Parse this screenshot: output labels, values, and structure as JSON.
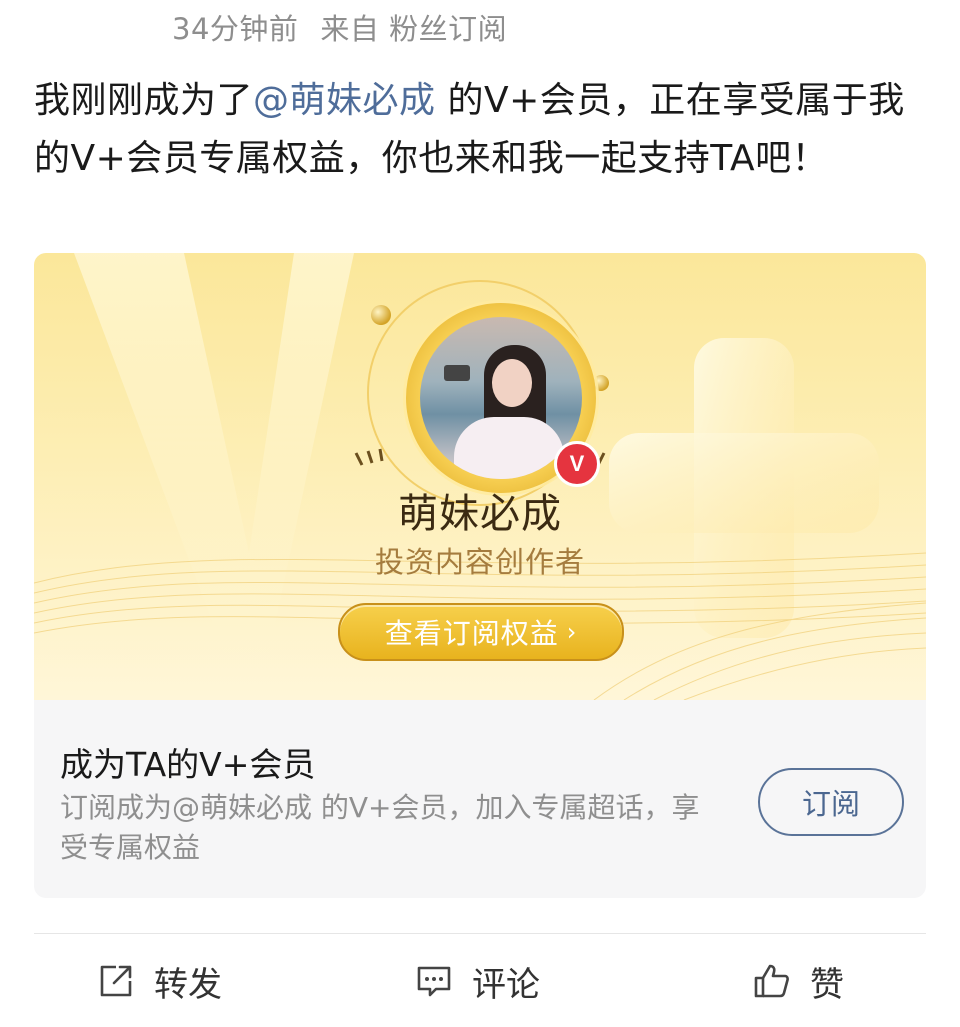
{
  "post": {
    "time": "34分钟前",
    "source": "来自 粉丝订阅",
    "text_before": "我刚刚成为了",
    "mention": "@萌妹必成",
    "text_after": " 的V+会员，正在享受属于我的V+会员专属权益，你也来和我一起支持TA吧！"
  },
  "banner": {
    "creator_name": "萌妹必成",
    "creator_role": "投资内容创作者",
    "badge_letter": "V",
    "benefits_button": "查看订阅权益",
    "benefits_chevron": "›"
  },
  "subscribe_card": {
    "title": "成为TA的V+会员",
    "description": "订阅成为@萌妹必成 的V+会员，加入专属超话，享受专属权益",
    "button": "订阅"
  },
  "actions": {
    "repost_label": "转发",
    "comment_label": "评论",
    "like_label": "赞"
  },
  "icons": {
    "repost": "share-icon",
    "comment": "comment-icon",
    "like": "thumbs-up-icon"
  },
  "colors": {
    "mention": "#4f6d9a",
    "gold": "#e8b31e",
    "subscribe_border": "#5a7398",
    "badge_red": "#e5343f"
  }
}
